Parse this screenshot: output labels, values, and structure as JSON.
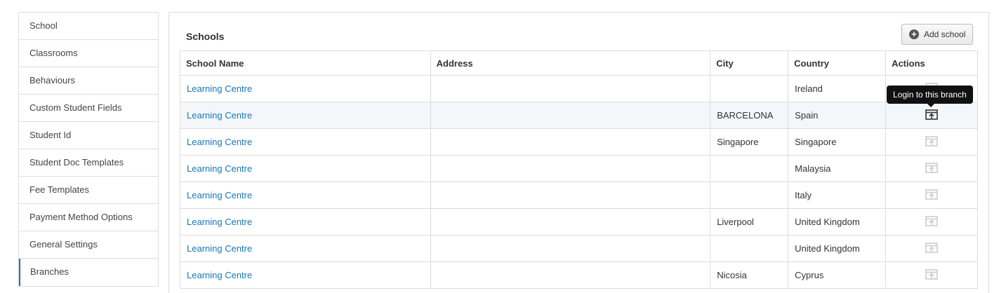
{
  "sidebar": {
    "items": [
      {
        "label": "School"
      },
      {
        "label": "Classrooms"
      },
      {
        "label": "Behaviours"
      },
      {
        "label": "Custom Student Fields"
      },
      {
        "label": "Student Id"
      },
      {
        "label": "Student Doc Templates"
      },
      {
        "label": "Fee Templates"
      },
      {
        "label": "Payment Method Options"
      },
      {
        "label": "General Settings"
      },
      {
        "label": "Branches"
      }
    ],
    "active_label": "Branches"
  },
  "panel": {
    "title": "Schools",
    "add_button_label": "Add school",
    "add_icon": "plus-circle-icon"
  },
  "table": {
    "columns": [
      "School Name",
      "Address",
      "City",
      "Country",
      "Actions"
    ],
    "rows": [
      {
        "name": "Learning Centre",
        "address": "",
        "city": "",
        "country": " Ireland"
      },
      {
        "name": "Learning Centre",
        "address": "",
        "city": "BARCELONA",
        "country": "Spain"
      },
      {
        "name": "Learning Centre",
        "address": "",
        "city": "Singapore",
        "country": "Singapore"
      },
      {
        "name": "Learning Centre",
        "address": "",
        "city": "",
        "country": "Malaysia"
      },
      {
        "name": "Learning Centre",
        "address": "",
        "city": "",
        "country": "Italy"
      },
      {
        "name": "Learning Centre",
        "address": "",
        "city": "Liverpool",
        "country": "United Kingdom"
      },
      {
        "name": "Learning Centre",
        "address": "",
        "city": "",
        "country": "United Kingdom"
      },
      {
        "name": "Learning Centre",
        "address": "",
        "city": "Nicosia",
        "country": "Cyprus"
      }
    ],
    "action_icon": "login-branch-icon"
  },
  "tooltip": {
    "text": "Login to this branch"
  },
  "colors": {
    "link": "#1b75bb",
    "border": "#dddddd",
    "icon_active": "#333333",
    "icon_inactive": "#cccccc",
    "tooltip_bg": "#111111"
  }
}
